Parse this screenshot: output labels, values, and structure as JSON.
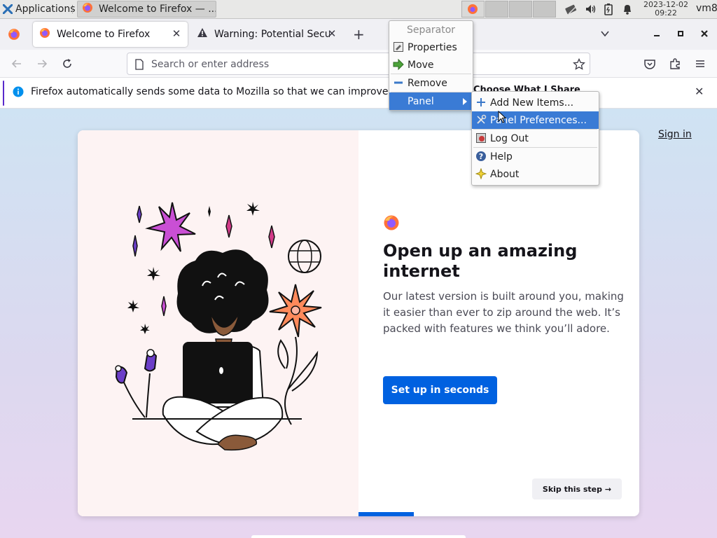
{
  "panel": {
    "applications_label": "Applications",
    "task_title": "Welcome to Firefox — ...",
    "clock_date": "2023-12-02",
    "clock_time": "09:22",
    "user": "vm8"
  },
  "browser": {
    "tabs": [
      {
        "label": "Welcome to Firefox",
        "active": true
      },
      {
        "label": "Warning: Potential Security Risk Ahead",
        "active": false
      }
    ],
    "urlbar_placeholder": "Search or enter address",
    "notification": {
      "message": "Firefox automatically sends some data to Mozilla so that we can improve your experience.",
      "button": "Choose What I Share"
    }
  },
  "welcome": {
    "sign_in": "Sign in",
    "headline": "Open up an amazing internet",
    "subtext": "Our latest version is built around you, making it easier than ever to zip around the web. It’s packed with features we think you’ll adore.",
    "primary_button": "Set up in seconds",
    "skip_button": "Skip this step →",
    "progress": 0.2
  },
  "context_menu": {
    "header": "Separator",
    "items": [
      "Properties",
      "Move",
      "Remove",
      "Panel"
    ]
  },
  "submenu": {
    "items": [
      "Add New Items...",
      "Panel Preferences...",
      "Log Out",
      "Help",
      "About"
    ],
    "selected": "Panel Preferences..."
  },
  "colors": {
    "accent": "#0061e0",
    "menu_selection": "#3a7bd5",
    "notification_accent": "#592acb"
  }
}
